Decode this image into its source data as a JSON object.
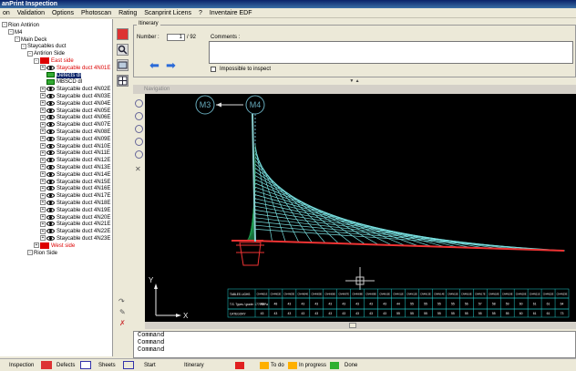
{
  "window": {
    "title": "anPrint Inspection"
  },
  "menu": [
    "on",
    "Validation",
    "Options",
    "Photoscan",
    "Rating",
    "Scanprint Licens",
    "?",
    "Inventaire EDF"
  ],
  "tree": {
    "items": [
      {
        "label": "Rion Antirion",
        "indent": 0,
        "kind": "plain"
      },
      {
        "label": "M4",
        "indent": 1,
        "kind": "plain"
      },
      {
        "label": "Main Deck",
        "indent": 2,
        "kind": "plain"
      },
      {
        "label": "Staycables duct",
        "indent": 3,
        "kind": "plain"
      },
      {
        "label": "Antirion Side",
        "indent": 4,
        "kind": "plain"
      },
      {
        "label": "East side",
        "indent": 5,
        "kind": "red"
      },
      {
        "label": "Staycable duct 4N01E",
        "indent": 6,
        "kind": "eye-red"
      },
      {
        "label": "Defects dl",
        "indent": 7,
        "kind": "green-sel"
      },
      {
        "label": "MBSCD dl",
        "indent": 7,
        "kind": "green"
      },
      {
        "label": "Staycable duct 4N02E",
        "indent": 6,
        "kind": "eye"
      },
      {
        "label": "Staycable duct 4N03E",
        "indent": 6,
        "kind": "eye"
      },
      {
        "label": "Staycable duct 4N04E",
        "indent": 6,
        "kind": "eye"
      },
      {
        "label": "Staycable duct 4N05E",
        "indent": 6,
        "kind": "eye"
      },
      {
        "label": "Staycable duct 4N06E",
        "indent": 6,
        "kind": "eye"
      },
      {
        "label": "Staycable duct 4N07E",
        "indent": 6,
        "kind": "eye"
      },
      {
        "label": "Staycable duct 4N08E",
        "indent": 6,
        "kind": "eye"
      },
      {
        "label": "Staycable duct 4N09E",
        "indent": 6,
        "kind": "eye"
      },
      {
        "label": "Staycable duct 4N10E",
        "indent": 6,
        "kind": "eye"
      },
      {
        "label": "Staycable duct 4N11E",
        "indent": 6,
        "kind": "eye"
      },
      {
        "label": "Staycable duct 4N12E",
        "indent": 6,
        "kind": "eye"
      },
      {
        "label": "Staycable duct 4N13E",
        "indent": 6,
        "kind": "eye"
      },
      {
        "label": "Staycable duct 4N14E",
        "indent": 6,
        "kind": "eye"
      },
      {
        "label": "Staycable duct 4N15E",
        "indent": 6,
        "kind": "eye"
      },
      {
        "label": "Staycable duct 4N16E",
        "indent": 6,
        "kind": "eye"
      },
      {
        "label": "Staycable duct 4N17E",
        "indent": 6,
        "kind": "eye"
      },
      {
        "label": "Staycable duct 4N18E",
        "indent": 6,
        "kind": "eye"
      },
      {
        "label": "Staycable duct 4N19E",
        "indent": 6,
        "kind": "eye"
      },
      {
        "label": "Staycable duct 4N20E",
        "indent": 6,
        "kind": "eye"
      },
      {
        "label": "Staycable duct 4N21E",
        "indent": 6,
        "kind": "eye"
      },
      {
        "label": "Staycable duct 4N22E",
        "indent": 6,
        "kind": "eye"
      },
      {
        "label": "Staycable duct 4N23E",
        "indent": 6,
        "kind": "eye"
      },
      {
        "label": "West side",
        "indent": 5,
        "kind": "red"
      },
      {
        "label": "Rion Side",
        "indent": 4,
        "kind": "plain"
      }
    ]
  },
  "itinerary": {
    "title": "Itinerary",
    "number_label": "Number :",
    "number_value": "1",
    "number_total": "/ 92",
    "comments_label": "Comments :",
    "impossible_label": "Impossible to inspect"
  },
  "navigation": {
    "title": "Navigation",
    "pylon_left": "M3",
    "pylon_right": "M4",
    "axis_y": "Y",
    "axis_x": "X",
    "table": {
      "rows": [
        {
          "label": "TABLES LIGHS",
          "cells": [
            "CN4N01E",
            "CN4N02E",
            "CN4N03E",
            "CN4N04E",
            "CN4N05E",
            "CN4N06E",
            "CN4N07E",
            "CN4N08E",
            "CN4N09E",
            "CN4N10E",
            "CN4N11E",
            "CN4N12E",
            "CN4N13E",
            "CN4N14E",
            "CN4N15E",
            "CN4N16E",
            "CN4N17E",
            "CN4N18E",
            "CN4N19E",
            "CN4N20E",
            "CN4N21E",
            "CN4N22E",
            "CN4N23E"
          ]
        },
        {
          "label": "T.S. Types / grade: 1770 MPa",
          "cells": [
            "48",
            "48",
            "43",
            "43",
            "43",
            "43",
            "43",
            "43",
            "43",
            "43",
            "44",
            "55",
            "55",
            "55",
            "55",
            "56",
            "57",
            "58",
            "59",
            "60",
            "61",
            "61",
            "64"
          ]
        },
        {
          "label": "CATEGORY",
          "cells": [
            "43",
            "43",
            "43",
            "43",
            "43",
            "43",
            "43",
            "43",
            "43",
            "43",
            "55",
            "55",
            "55",
            "55",
            "55",
            "55",
            "55",
            "55",
            "55",
            "60",
            "61",
            "61",
            "73"
          ]
        }
      ]
    }
  },
  "command": {
    "lines": [
      "Command",
      "Command",
      "Command"
    ]
  },
  "bottom": {
    "tabs": [
      "Inspection",
      "Defects",
      "Sheets",
      "Start"
    ],
    "itinerary": "Itinerary",
    "legend": [
      {
        "label": "",
        "color": "#e02020"
      },
      {
        "label": "To do",
        "color": "#ffb000"
      },
      {
        "label": "In progress",
        "color": "#ffb000"
      },
      {
        "label": "Done",
        "color": "#30b030"
      }
    ]
  }
}
